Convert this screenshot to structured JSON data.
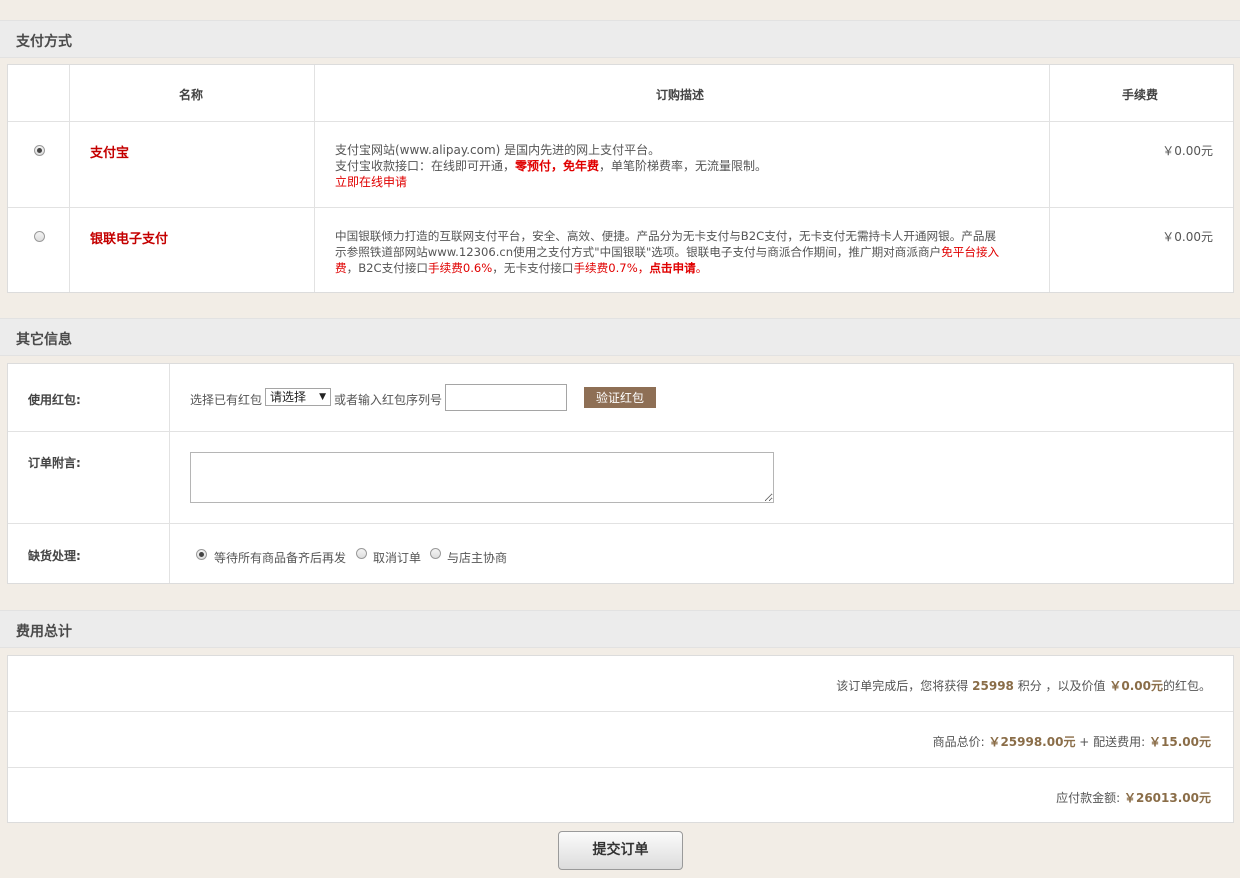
{
  "payment": {
    "section_title": "支付方式",
    "columns": [
      "名称",
      "订购描述",
      "手续费"
    ],
    "methods": [
      {
        "name": "支付宝",
        "selected": true,
        "desc_line1": "支付宝网站(www.alipay.com) 是国内先进的网上支付平台。",
        "desc_line2_pre": "支付宝收款接口：在线即可开通，",
        "desc_line2_hl1": "零预付，",
        "desc_line2_hl2": "免年费",
        "desc_line2_post": "，单笔阶梯费率，无流量限制。",
        "apply_link": "立即在线申请",
        "fee": "￥0.00元"
      },
      {
        "name": "银联电子支付",
        "selected": false,
        "desc_line1": "中国银联倾力打造的互联网支付平台，安全、高效、便捷。产品分为无卡支付与B2C支付，无卡支付无需持卡人开通网银。产品展",
        "desc_line2_pre": "示参照铁道部网站www.12306.cn使用之支付方式\"中国银联\"选项。银联电子支付与商派合作期间，推广期对商派商户",
        "desc_line2_hl": "免平台接入",
        "desc_line3_hl1": "费",
        "desc_line3_a": "，B2C支付接口",
        "desc_line3_hl2": "手续费",
        "desc_line3_b": "0.6%",
        "desc_line3_c": "，无卡支付接口",
        "desc_line3_hl3": "手续费",
        "desc_line3_d": "0.7%",
        "desc_line3_e": "，",
        "desc_line3_link": "点击申请",
        "desc_line3_f": "。",
        "fee": "￥0.00元"
      }
    ]
  },
  "other": {
    "section_title": "其它信息",
    "bonus_label": "使用红包:",
    "bonus_choose_text": "选择已有红包",
    "bonus_select_value": "请选择",
    "bonus_or_text": "或者输入红包序列号",
    "bonus_input_value": "",
    "verify_button": "验证红包",
    "memo_label": "订单附言:",
    "memo_value": "",
    "shortage_label": "缺货处理:",
    "shortage_options": [
      {
        "label": "等待所有商品备齐后再发",
        "selected": true
      },
      {
        "label": "取消订单",
        "selected": false
      },
      {
        "label": "与店主协商",
        "selected": false
      }
    ]
  },
  "summary": {
    "section_title": "费用总计",
    "points_pre": "该订单完成后，您将获得",
    "points_value": "25998",
    "points_mid": "积分 ，以及价值",
    "bonus_value": "￥0.00元",
    "points_post": "的红包。",
    "goods_label": "商品总价:",
    "goods_value": "￥25998.00元",
    "shipping_label": "+ 配送费用:",
    "shipping_value": "￥15.00元",
    "total_label": "应付款金额:",
    "total_value": "￥26013.00元"
  },
  "submit_button": "提交订单"
}
